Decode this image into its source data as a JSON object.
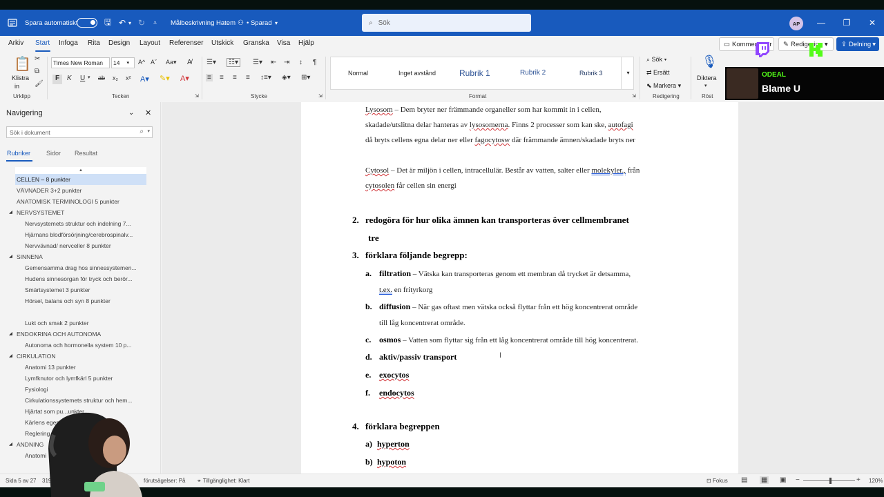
{
  "titlebar": {
    "autosave_label": "Spara automatiskt",
    "doc_title": "Målbeskrivning Hatem",
    "saved_label": "• Sparad",
    "search_placeholder": "Sök",
    "avatar_initials": "AP"
  },
  "menu": {
    "tabs": [
      "Arkiv",
      "Start",
      "Infoga",
      "Rita",
      "Design",
      "Layout",
      "Referenser",
      "Utskick",
      "Granska",
      "Visa",
      "Hjälp"
    ],
    "active_tab": "Start",
    "comments_btn": "Kommentarer",
    "editing_btn": "Redigering",
    "share_btn": "Delning"
  },
  "ribbon": {
    "paste_label_1": "Klistra",
    "paste_label_2": "in",
    "group_clipboard": "Urklipp",
    "font_name": "Times New Roman",
    "font_size": "14",
    "group_font": "Tecken",
    "group_paragraph": "Stycke",
    "styles": [
      "Normal",
      "Inget avstånd",
      "Rubrik 1",
      "Rubrik 2",
      "Rubrik 3"
    ],
    "group_styles": "Format",
    "find": "Sök",
    "replace": "Ersätt",
    "select": "Markera",
    "group_editing": "Redigering",
    "dictate": "Diktera",
    "group_voice": "Röst"
  },
  "nav": {
    "title": "Navigering",
    "search_placeholder": "Sök i dokument",
    "tabs": [
      "Rubriker",
      "Sidor",
      "Resultat"
    ],
    "items": [
      {
        "label": "CELLEN – 8 punkter",
        "level": 1
      },
      {
        "label": "VÄVNADER 3+2 punkter",
        "level": 1
      },
      {
        "label": "ANATOMISK TERMINOLOGI 5 punkter",
        "level": 1
      },
      {
        "label": "NERVSYSTEMET",
        "level": 1
      },
      {
        "label": "Nervsystemets struktur och indelning 7...",
        "level": 2
      },
      {
        "label": "Hjärnans blodförsörjning/cerebrospinalv...",
        "level": 2
      },
      {
        "label": "Nervvävnad/ nervceller 8 punkter",
        "level": 2
      },
      {
        "label": "SINNENA",
        "level": 1
      },
      {
        "label": "Gemensamma drag hos sinnessystemen...",
        "level": 2
      },
      {
        "label": "Hudens sinnesorgan för tryck och berör...",
        "level": 2
      },
      {
        "label": "Smärtsystemet 3 punkter",
        "level": 2
      },
      {
        "label": "Hörsel, balans och syn 8 punkter",
        "level": 2
      },
      {
        "label": "Lukt och smak 2 punkter",
        "level": 2
      },
      {
        "label": "ENDOKRINA OCH AUTONOMA",
        "level": 1
      },
      {
        "label": "Autonoma och hormonella system 10 p...",
        "level": 2
      },
      {
        "label": "CIRKULATION",
        "level": 1
      },
      {
        "label": "Anatomi 13 punkter",
        "level": 2
      },
      {
        "label": "Lymfknutor och lymfkärl 5 punkter",
        "level": 2
      },
      {
        "label": "Fysiologi",
        "level": 2
      },
      {
        "label": "Cirkulationssystemets struktur och hem...",
        "level": 2
      },
      {
        "label": "Hjärtat som pu...unkter",
        "level": 2
      },
      {
        "label": "Kärlens egens...",
        "level": 2
      },
      {
        "label": "Reglering av ...cula...",
        "level": 2
      },
      {
        "label": "ANDNING",
        "level": 1
      },
      {
        "label": "Anatomi",
        "level": 2
      }
    ]
  },
  "doc": {
    "lysosom_term": "Lysosom",
    "lysosom_l1": " – Dem bryter ner främmande organeller som har kommit in i cellen,",
    "lysosom_l2a": "skadade/utslitna delar hanteras av ",
    "lysosom_l2b": "lysosomerna",
    "lysosom_l2c": ". Finns 2 processer som kan ske, ",
    "lysosom_l2d": "autofagi",
    "lysosom_l3a": "då bryts cellens egna delar ner eller ",
    "lysosom_l3b": "fagocytosw",
    "lysosom_l3c": " där främmande ämnen/skadade bryts ner",
    "cytosol_term": "Cytosol",
    "cytosol_l1a": " – Det är miljön i cellen, intracellulär. Består av vatten, salter eller ",
    "cytosol_l1b": "molekyler.,",
    "cytosol_l1c": " från",
    "cytosol_l2a": "cytosolen",
    "cytosol_l2b": " får cellen sin energi",
    "q2_num": "2.",
    "q2_text": "redogöra för hur olika ämnen kan transporteras över cellmembranet",
    "q2_cont": "tre",
    "q3_num": "3.",
    "q3_text": "förklara följande begrepp:",
    "a_mark": "a.",
    "a_term": "filtration",
    "a_def": " – Vätska kan transporteras genom ett membran då trycket är detsamma,",
    "a_cont_a": "t.ex.",
    "a_cont_b": " en frityrkorg",
    "b_mark": "b.",
    "b_term": "diffusion",
    "b_def": " – När gas oftast men vätska också flyttar från ett hög koncentrerat område",
    "b_cont": "till låg koncentrerat område.",
    "c_mark": "c.",
    "c_term": "osmos",
    "c_def": " – Vatten som flyttar sig från ett låg koncentrerat område till hög koncentrerat.",
    "d_mark": "d.",
    "d_term": "aktiv/passiv transport",
    "e_mark": "e.",
    "e_term": "exocytos",
    "f_mark": "f.",
    "f_term": "endocytos",
    "q4_num": "4.",
    "q4_text": "förklara begreppen",
    "q4a_mark": "a)",
    "q4a_term": "hyperton",
    "q4b_mark": "b)",
    "q4b_term": "hypoton"
  },
  "status": {
    "page": "Sida 5 av 27",
    "words": "319",
    "prediction": "förutsägelser: På",
    "accessibility": "Tillgänglighet: Klart",
    "focus": "Fokus",
    "zoom": "120%"
  },
  "overlay": {
    "channel": "ODEAL",
    "song": "Blame U"
  },
  "colors": {
    "word_blue": "#185abd",
    "kick_green": "#53fc18",
    "twitch_purple": "#9146ff"
  }
}
